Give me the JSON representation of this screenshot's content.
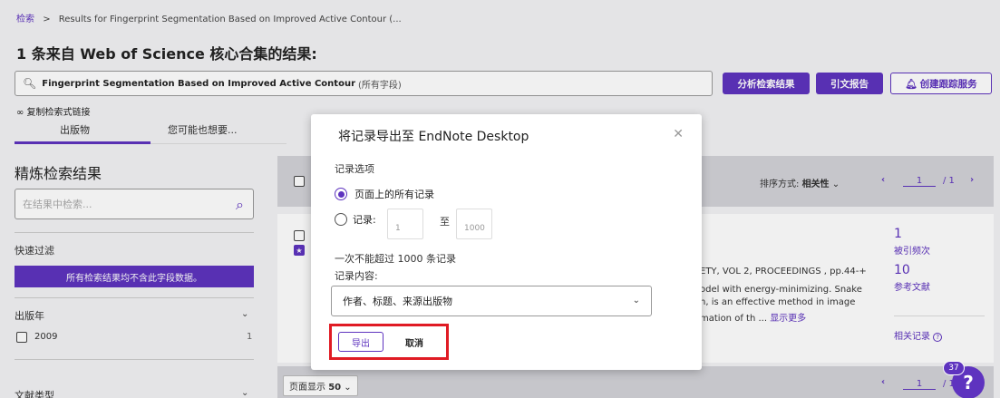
{
  "breadcrumb": {
    "link": "检索",
    "separator": ">",
    "current": "Results for Fingerprint Segmentation Based on Improved Active Contour (..."
  },
  "heading": "1 条来自 Web of Science 核心合集的结果:",
  "search": {
    "query": "Fingerprint Segmentation Based on Improved Active Contour",
    "scope": "(所有字段)"
  },
  "actions": {
    "analyze": "分析检索结果",
    "citation_report": "引文报告",
    "create_alert": "创建跟踪服务"
  },
  "copy_link": "复制检索式链接",
  "tabs": [
    "出版物",
    "您可能也想要..."
  ],
  "sidebar": {
    "refine_title": "精炼检索结果",
    "refine_placeholder": "在结果中检索...",
    "quick_filter": "快速过滤",
    "banner": "所有检索结果均不含此字段数据。",
    "pub_year_label": "出版年",
    "year_item": "2009",
    "year_count": "1",
    "doc_type_label": "文献类型"
  },
  "results_bar": {
    "sort_label": "排序方式:",
    "sort_value": "相关性",
    "page_current": "1",
    "page_total": "/ 1"
  },
  "result": {
    "source_snippet": "ETY, VOL 2, PROCEEDINGS , pp.44-+",
    "abstract_line1": "odel with energy-minimizing. Snake",
    "abstract_line2": "n, is an effective method in image",
    "abstract_line3": "mation of th ...",
    "show_more": "显示更多",
    "citations_count": "1",
    "citations_label": "被引频次",
    "refs_count": "10",
    "refs_label": "参考文献",
    "related": "相关记录"
  },
  "bottom_bar": {
    "page_size_label": "页面显示",
    "page_size_value": "50",
    "page_current": "1",
    "page_total": "/ 1"
  },
  "help_badge": "37",
  "modal": {
    "title": "将记录导出至 EndNote Desktop",
    "record_options": "记录选项",
    "option_all": "页面上的所有记录",
    "option_range": "记录:",
    "range_from": "1",
    "range_to_label": "至",
    "range_to": "1000",
    "limit_note": "一次不能超过 1000 条记录",
    "content_label": "记录内容:",
    "content_value": "作者、标题、来源出版物",
    "export_button": "导出",
    "cancel_button": "取消"
  }
}
